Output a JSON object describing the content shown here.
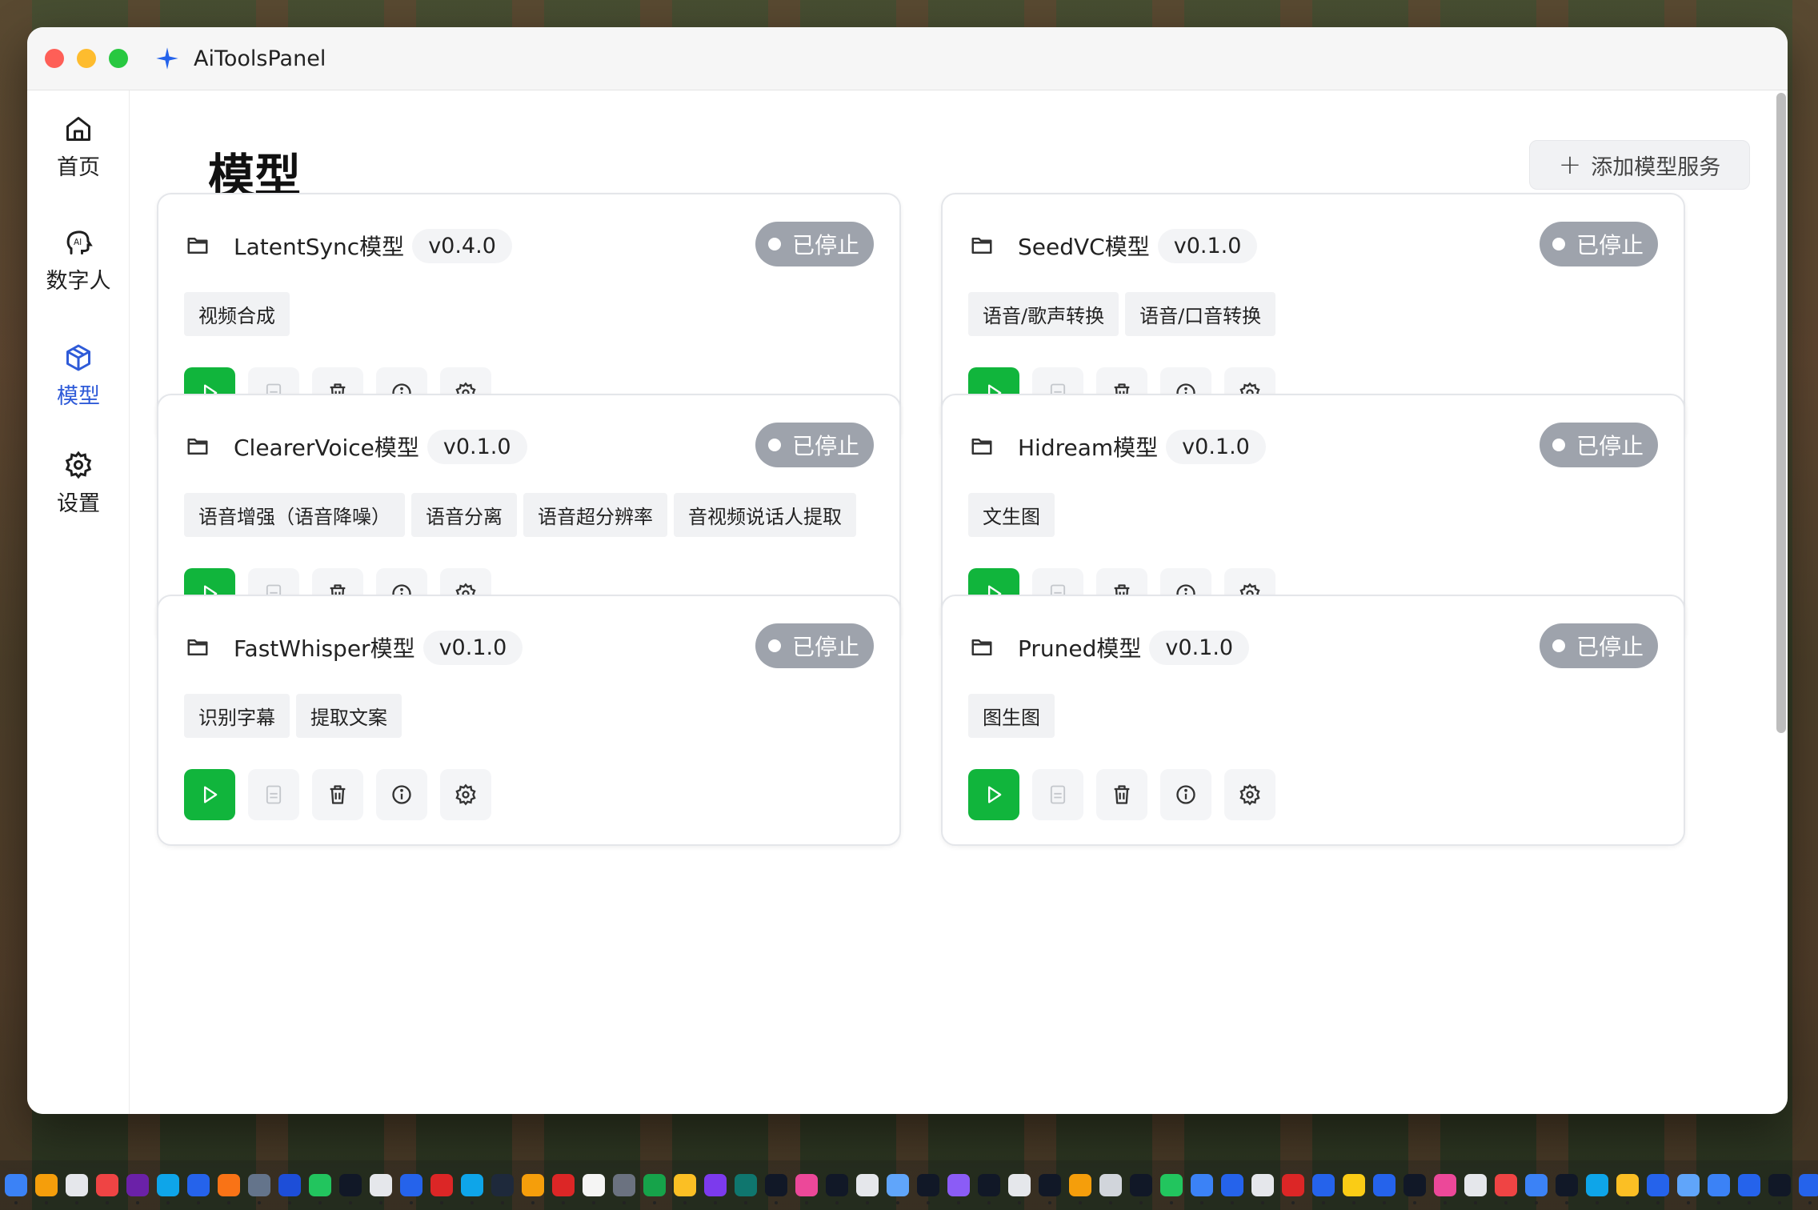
{
  "app": {
    "title": "AiToolsPanel"
  },
  "sidebar": {
    "items": [
      {
        "label": "首页",
        "icon": "home-icon",
        "active": false
      },
      {
        "label": "数字人",
        "icon": "ai-head-icon",
        "active": false
      },
      {
        "label": "模型",
        "icon": "cube-icon",
        "active": true
      },
      {
        "label": "设置",
        "icon": "gear-icon",
        "active": false
      }
    ]
  },
  "main": {
    "title": "模型",
    "add_button_label": "添加模型服务",
    "cards": [
      {
        "name": "LatentSync模型",
        "version": "v0.4.0",
        "status": "已停止",
        "tags": [
          "视频合成"
        ]
      },
      {
        "name": "SeedVC模型",
        "version": "v0.1.0",
        "status": "已停止",
        "tags": [
          "语音/歌声转换",
          "语音/口音转换"
        ]
      },
      {
        "name": "ClearerVoice模型",
        "version": "v0.1.0",
        "status": "已停止",
        "tags": [
          "语音增强（语音降噪）",
          "语音分离",
          "语音超分辨率",
          "音视频说话人提取"
        ]
      },
      {
        "name": "Hidream模型",
        "version": "v0.1.0",
        "status": "已停止",
        "tags": [
          "文生图"
        ]
      },
      {
        "name": "FastWhisper模型",
        "version": "v0.1.0",
        "status": "已停止",
        "tags": [
          "识别字幕",
          "提取文案"
        ]
      },
      {
        "name": "Pruned模型",
        "version": "v0.1.0",
        "status": "已停止",
        "tags": [
          "图生图"
        ]
      }
    ]
  },
  "colors": {
    "accent": "#2f5bd8",
    "play": "#11b53c",
    "status_stopped": "#9ea3ac"
  },
  "dock": {
    "icon_colors": [
      "#3b82f6",
      "#f59e0b",
      "#e5e7eb",
      "#ef4444",
      "#6b21a8",
      "#0ea5e9",
      "#2563eb",
      "#f97316",
      "#64748b",
      "#1d4ed8",
      "#22c55e",
      "#111827",
      "#e5e7eb",
      "#2563eb",
      "#dc2626",
      "#0ea5e9",
      "#1e293b",
      "#f59e0b",
      "#dc2626",
      "#f5f5f4",
      "#6b7280",
      "#16a34a",
      "#fbbf24",
      "#7c3aed",
      "#0f766e",
      "#111827",
      "#ec4899",
      "#111827",
      "#e5e7eb",
      "#60a5fa",
      "#111827",
      "#8b5cf6",
      "#111827",
      "#e5e7eb",
      "#111827",
      "#f59e0b",
      "#d1d5db",
      "#111827",
      "#22c55e",
      "#3b82f6",
      "#2563eb",
      "#e5e7eb",
      "#dc2626",
      "#2563eb",
      "#facc15",
      "#2563eb",
      "#111827",
      "#ec4899",
      "#e5e7eb",
      "#ef4444",
      "#3b82f6",
      "#111827",
      "#0ea5e9",
      "#fbbf24",
      "#2563eb",
      "#60a5fa",
      "#3b82f6",
      "#2563eb",
      "#111827",
      "#2563eb"
    ]
  }
}
